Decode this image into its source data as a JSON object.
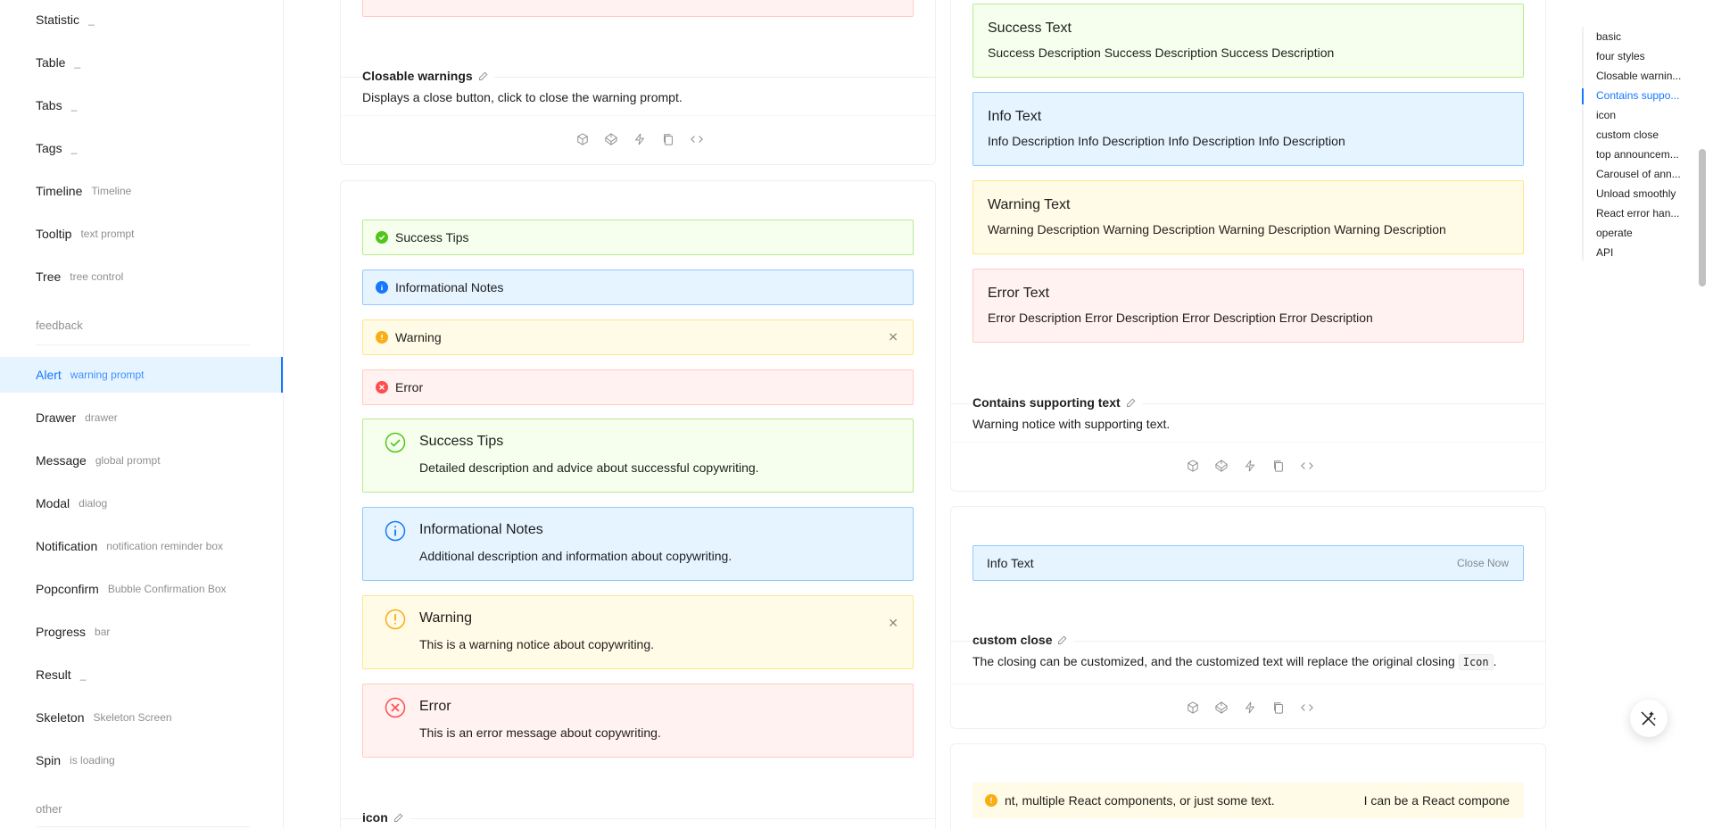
{
  "sidebar": {
    "items": [
      {
        "title": "Statistic",
        "subtitle": "_"
      },
      {
        "title": "Table",
        "subtitle": "_"
      },
      {
        "title": "Tabs",
        "subtitle": "_"
      },
      {
        "title": "Tags",
        "subtitle": "_"
      },
      {
        "title": "Timeline",
        "subtitle": "Timeline"
      },
      {
        "title": "Tooltip",
        "subtitle": "text prompt"
      },
      {
        "title": "Tree",
        "subtitle": "tree control"
      },
      {
        "title": "Alert",
        "subtitle": "warning prompt"
      },
      {
        "title": "Drawer",
        "subtitle": "drawer"
      },
      {
        "title": "Message",
        "subtitle": "global prompt"
      },
      {
        "title": "Modal",
        "subtitle": "dialog"
      },
      {
        "title": "Notification",
        "subtitle": "notification reminder box"
      },
      {
        "title": "Popconfirm",
        "subtitle": "Bubble Confirmation Box"
      },
      {
        "title": "Progress",
        "subtitle": "bar"
      },
      {
        "title": "Result",
        "subtitle": "_"
      },
      {
        "title": "Skeleton",
        "subtitle": "Skeleton Screen"
      },
      {
        "title": "Spin",
        "subtitle": "is loading"
      }
    ],
    "group_feedback": "feedback",
    "group_other": "other"
  },
  "left": {
    "closable": {
      "title": "Closable warnings",
      "desc": "Displays a close button, click to close the warning prompt."
    },
    "styles_demo": {
      "small": [
        {
          "type": "success",
          "text": "Success Tips"
        },
        {
          "type": "info",
          "text": "Informational Notes"
        },
        {
          "type": "warning",
          "text": "Warning"
        },
        {
          "type": "error",
          "text": "Error"
        }
      ],
      "big": [
        {
          "type": "success",
          "title": "Success Tips",
          "desc": "Detailed description and advice about successful copywriting."
        },
        {
          "type": "info",
          "title": "Informational Notes",
          "desc": "Additional description and information about copywriting."
        },
        {
          "type": "warning",
          "title": "Warning",
          "desc": "This is a warning notice about copywriting."
        },
        {
          "type": "error",
          "title": "Error",
          "desc": "This is an error message about copywriting."
        }
      ],
      "icon_title": "icon"
    }
  },
  "right": {
    "plain": [
      {
        "type": "success",
        "title": "Success Text",
        "desc": "Success Description Success Description Success Description"
      },
      {
        "type": "info",
        "title": "Info Text",
        "desc": "Info Description Info Description Info Description Info Description"
      },
      {
        "type": "warning",
        "title": "Warning Text",
        "desc": "Warning Description Warning Description Warning Description Warning Description"
      },
      {
        "type": "error",
        "title": "Error Text",
        "desc": "Error Description Error Description Error Description Error Description"
      }
    ],
    "supporting": {
      "title": "Contains supporting text",
      "desc": "Warning notice with supporting text."
    },
    "custom_close": {
      "alert_text": "Info Text",
      "close_text": "Close Now",
      "title": "custom close",
      "desc_before": "The closing can be customized, and the customized text will replace the original closing",
      "code": "Icon",
      "desc_after": "."
    },
    "marquee": {
      "text_a": "nt, multiple React components, or just some text.",
      "text_b": "I can be a React compone"
    }
  },
  "toc": {
    "links": [
      "basic",
      "four styles",
      "Closable warnin...",
      "Contains suppo...",
      "icon",
      "custom close",
      "top announcem...",
      "Carousel of ann...",
      "Unload smoothly",
      "React error han...",
      "operate",
      "API"
    ],
    "active_index": 3
  },
  "colors": {
    "primary": "#1677ff",
    "success": "#52c41a",
    "info": "#1677ff",
    "warning": "#faad14",
    "error": "#ff4d4f"
  }
}
